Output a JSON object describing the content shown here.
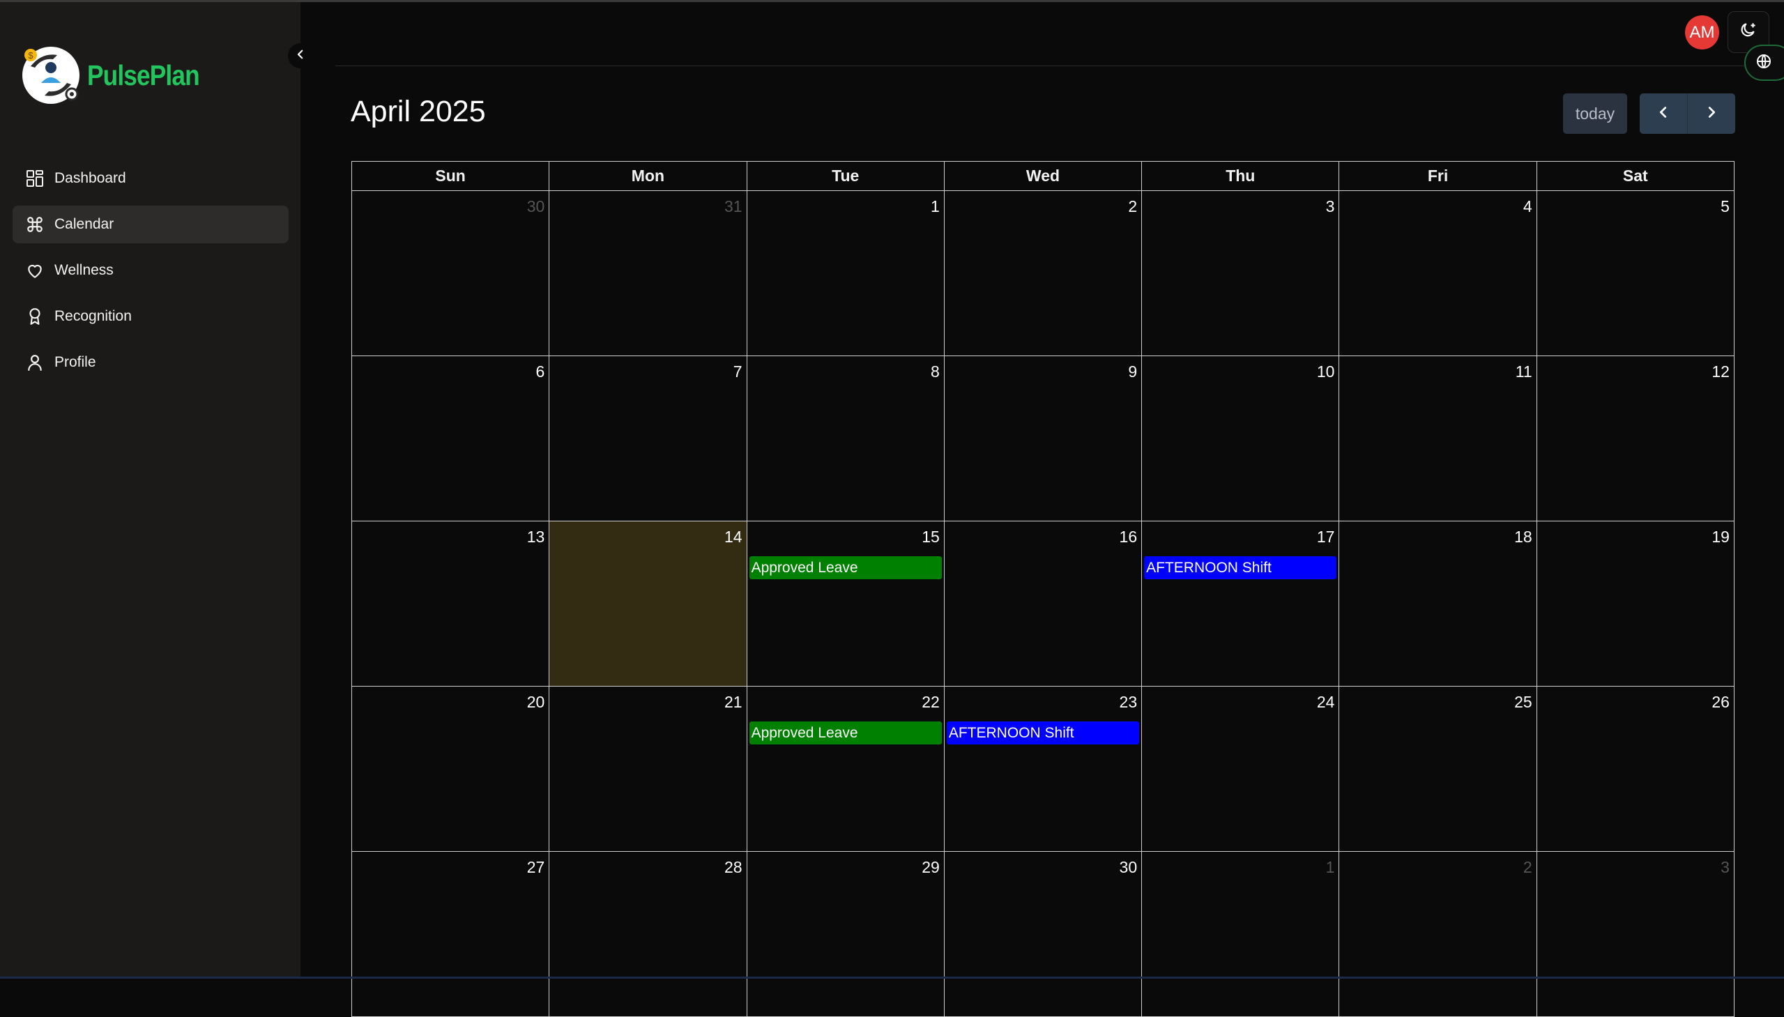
{
  "app": {
    "name": "PulsePlan"
  },
  "sidebar": {
    "items": [
      {
        "label": "Dashboard",
        "icon": "dashboard-icon"
      },
      {
        "label": "Calendar",
        "icon": "command-icon"
      },
      {
        "label": "Wellness",
        "icon": "heart-icon"
      },
      {
        "label": "Recognition",
        "icon": "award-icon"
      },
      {
        "label": "Profile",
        "icon": "user-icon"
      }
    ],
    "active_item": "Calendar"
  },
  "header": {
    "avatar_initials": "AM",
    "avatar_color": "#e53935"
  },
  "calendar": {
    "title": "April 2025",
    "today_label": "today",
    "weekdays": [
      "Sun",
      "Mon",
      "Tue",
      "Wed",
      "Thu",
      "Fri",
      "Sat"
    ],
    "weeks": [
      [
        "30",
        "31",
        "1",
        "2",
        "3",
        "4",
        "5"
      ],
      [
        "6",
        "7",
        "8",
        "9",
        "10",
        "11",
        "12"
      ],
      [
        "13",
        "14",
        "15",
        "16",
        "17",
        "18",
        "19"
      ],
      [
        "20",
        "21",
        "22",
        "23",
        "24",
        "25",
        "26"
      ],
      [
        "27",
        "28",
        "29",
        "30",
        "1",
        "2",
        "3"
      ]
    ],
    "today_date": "14",
    "events": [
      {
        "date": "15",
        "title": "Approved Leave",
        "color": "#008000"
      },
      {
        "date": "17",
        "title": "AFTERNOON Shift",
        "color": "#0000ff"
      },
      {
        "date": "22",
        "title": "Approved Leave",
        "color": "#008000"
      },
      {
        "date": "23",
        "title": "AFTERNOON Shift",
        "color": "#0000ff"
      }
    ]
  },
  "colors": {
    "brand": "#22c55e",
    "today_highlight": "#332c13",
    "leave": "#008000",
    "shift": "#0000ff"
  }
}
